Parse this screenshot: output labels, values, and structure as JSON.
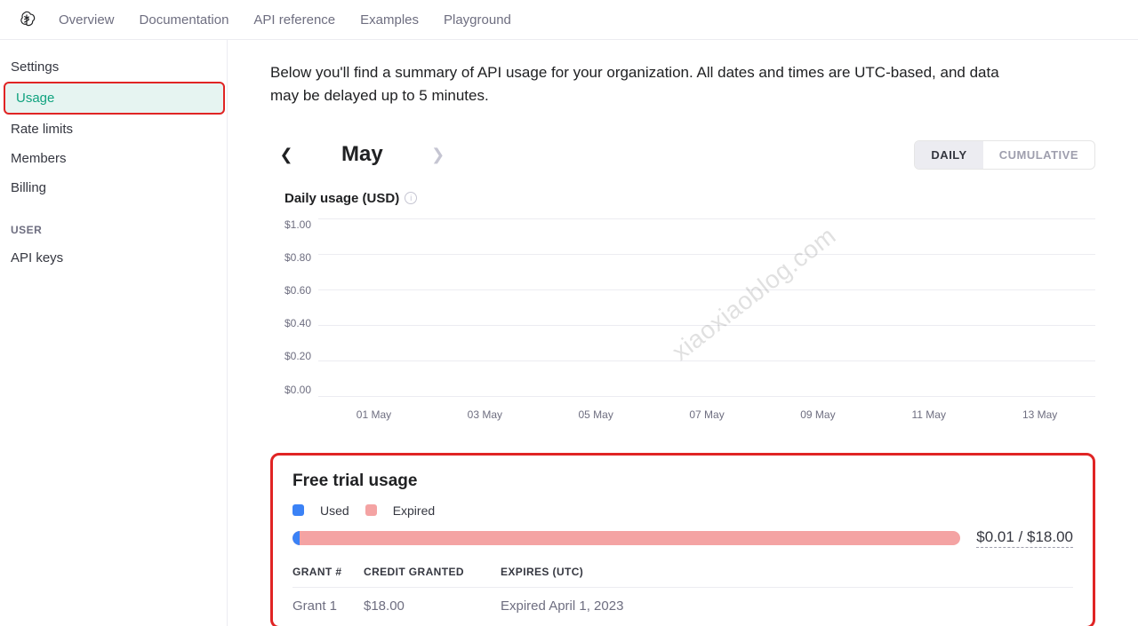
{
  "topnav": {
    "links": [
      "Overview",
      "Documentation",
      "API reference",
      "Examples",
      "Playground"
    ]
  },
  "sidebar": {
    "items": [
      "Settings",
      "Usage",
      "Rate limits",
      "Members",
      "Billing"
    ],
    "user_heading": "USER",
    "user_items": [
      "API keys"
    ],
    "active_index": 1
  },
  "intro": "Below you'll find a summary of API usage for your organization. All dates and times are UTC-based, and data may be delayed up to 5 minutes.",
  "month": {
    "label": "May",
    "prev_enabled": true,
    "next_enabled": false
  },
  "toggle": {
    "options": [
      "DAILY",
      "CUMULATIVE"
    ],
    "active_index": 0
  },
  "chart_data": {
    "type": "bar",
    "title": "Daily usage (USD)",
    "ylabel": "",
    "xlabel": "",
    "ylim": [
      0,
      1.0
    ],
    "y_ticks": [
      "$1.00",
      "$0.80",
      "$0.60",
      "$0.40",
      "$0.20",
      "$0.00"
    ],
    "categories": [
      "01 May",
      "03 May",
      "05 May",
      "07 May",
      "09 May",
      "11 May",
      "13 May"
    ],
    "values": [
      0,
      0,
      0,
      0,
      0,
      0,
      0
    ]
  },
  "watermark": "xiaoxiaoblog.com",
  "trial": {
    "title": "Free trial usage",
    "legend": {
      "used": "Used",
      "expired": "Expired"
    },
    "summary": "$0.01 / $18.00",
    "columns": {
      "grant": "GRANT #",
      "credit": "CREDIT GRANTED",
      "expires": "EXPIRES (UTC)"
    },
    "rows": [
      {
        "grant": "Grant 1",
        "credit": "$18.00",
        "expires": "Expired April 1, 2023"
      }
    ]
  }
}
